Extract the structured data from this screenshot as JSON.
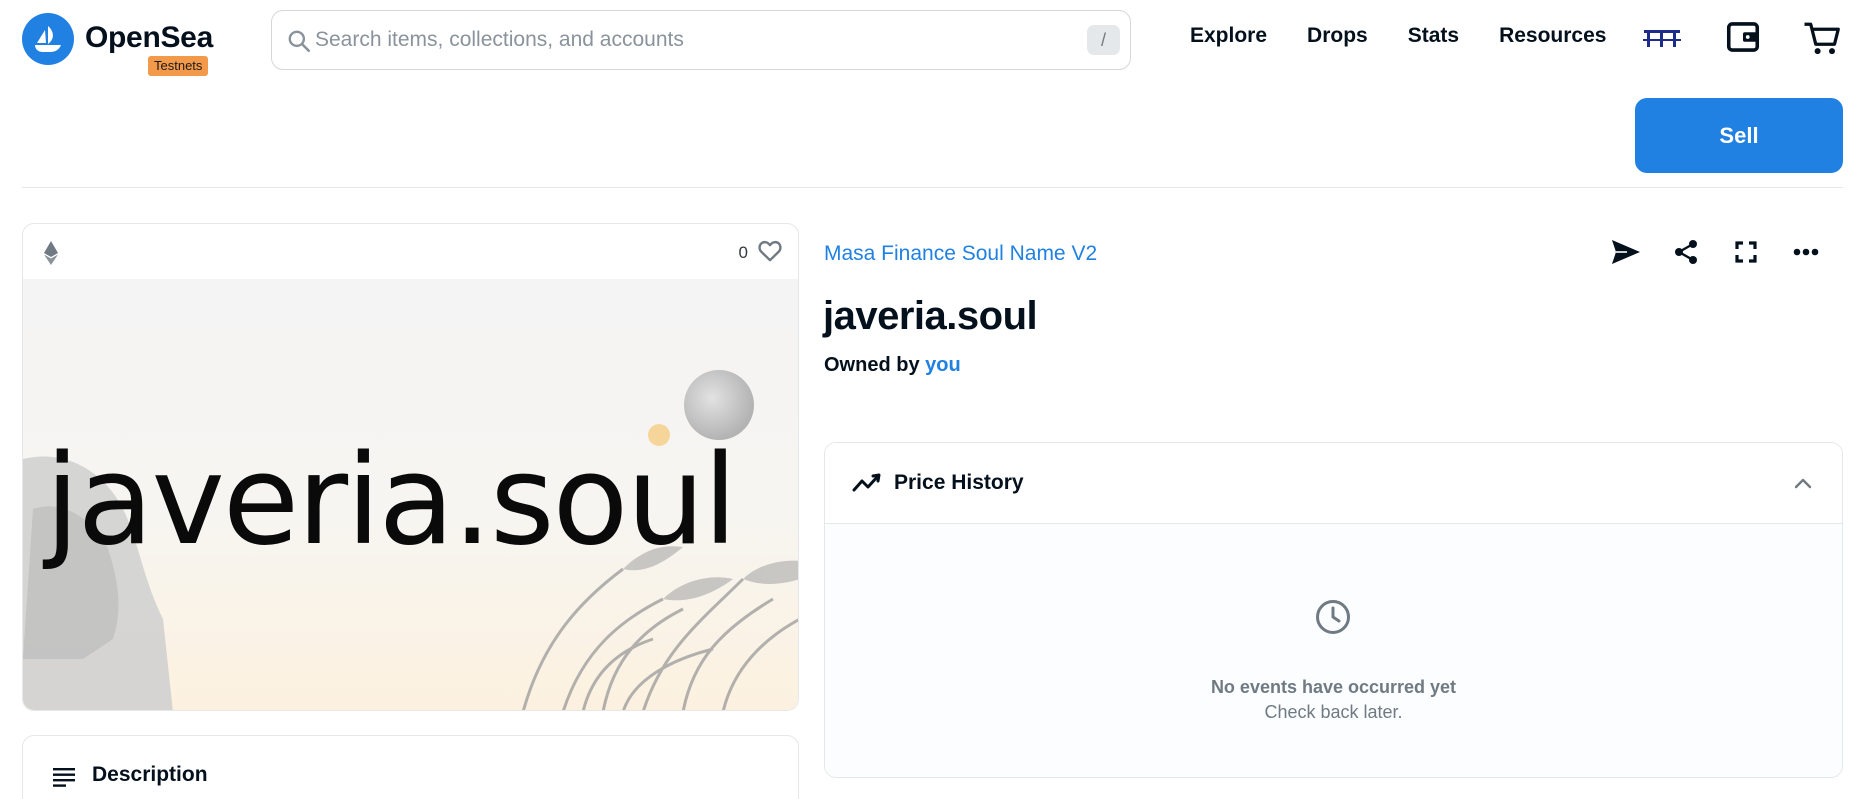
{
  "header": {
    "brand": "OpenSea",
    "network_badge": "Testnets",
    "search": {
      "placeholder": "Search items, collections, and accounts",
      "value": "",
      "shortcut_key": "/"
    },
    "nav": [
      "Explore",
      "Drops",
      "Stats",
      "Resources"
    ],
    "icons": {
      "avatar": "profile-avatar",
      "wallet": "wallet-icon",
      "cart": "cart-icon"
    }
  },
  "toolbar": {
    "sell_label": "Sell"
  },
  "asset": {
    "chain_icon": "ethereum-icon",
    "favorite_count": "0",
    "image_text": "javeria.soul"
  },
  "description": {
    "title": "Description"
  },
  "item": {
    "collection": "Masa Finance Soul Name V2",
    "name": "javeria.soul",
    "owned_by_label": "Owned by",
    "owner": "you",
    "actions": [
      "send-icon",
      "share-icon",
      "fullscreen-icon",
      "more-icon"
    ]
  },
  "price_history": {
    "title": "Price History",
    "empty_title": "No events have occurred yet",
    "empty_subtitle": "Check back later."
  },
  "colors": {
    "accent": "#2081e2",
    "badge": "#f2994a",
    "text": "#04111d",
    "muted": "#707a83",
    "border": "#e5e8eb"
  }
}
